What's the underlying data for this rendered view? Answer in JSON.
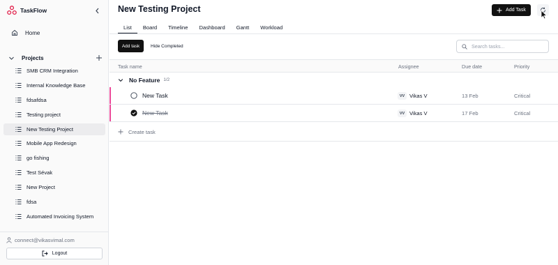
{
  "app": {
    "name": "TaskFlow"
  },
  "sidebar": {
    "home_label": "Home",
    "projects_label": "Projects",
    "projects": [
      {
        "label": "SMB CRM Integration"
      },
      {
        "label": "Internal Knowledge Base"
      },
      {
        "label": "fdsafdsa"
      },
      {
        "label": "Testing project"
      },
      {
        "label": "New Testing Project",
        "active": true
      },
      {
        "label": "Mobile App Redesign"
      },
      {
        "label": "go fishing"
      },
      {
        "label": "Test Sévak"
      },
      {
        "label": "New Project"
      },
      {
        "label": "fdsa"
      },
      {
        "label": "Automated Invoicing System"
      }
    ],
    "user_email": "connect@vikasvimal.com",
    "logout_label": "Logout"
  },
  "header": {
    "title": "New Testing Project",
    "add_task_label": "Add Task"
  },
  "tabs": [
    {
      "label": "List",
      "active": true
    },
    {
      "label": "Board"
    },
    {
      "label": "Timeline"
    },
    {
      "label": "Dashboard"
    },
    {
      "label": "Gantt"
    },
    {
      "label": "Workload"
    }
  ],
  "toolbar": {
    "add_task_label": "Add task",
    "hide_completed_label": "Hide Completed",
    "search_placeholder": "Search tasks..."
  },
  "table": {
    "columns": [
      "Task name",
      "Assignee",
      "Due date",
      "Priority"
    ],
    "group": {
      "name": "No Feature",
      "count": "1/2"
    },
    "rows": [
      {
        "name": "New Task",
        "done": false,
        "assignee_initials": "VV",
        "assignee": "Vikas V",
        "due": "13 Feb",
        "priority": "Critical"
      },
      {
        "name": "New Task",
        "done": true,
        "assignee_initials": "VV",
        "assignee": "Vikas V",
        "due": "17 Feb",
        "priority": "Critical"
      }
    ],
    "create_label": "Create task"
  },
  "colors": {
    "primary": "#111111",
    "row_accent": "#ec4899",
    "muted_text": "#6b7280",
    "border": "#e5e7eb"
  },
  "icons": {
    "brand": "taskflow-logo-icon",
    "collapse": "chevron-left-icon",
    "home": "home-icon",
    "projects_toggle": "chevron-down-icon",
    "add_project": "plus-icon",
    "project": "list-icon",
    "user": "user-icon",
    "logout": "logout-icon",
    "refresh": "refresh-icon",
    "search": "search-icon",
    "check_open": "circle-icon",
    "check_done": "check-circle-icon",
    "create": "plus-icon"
  }
}
